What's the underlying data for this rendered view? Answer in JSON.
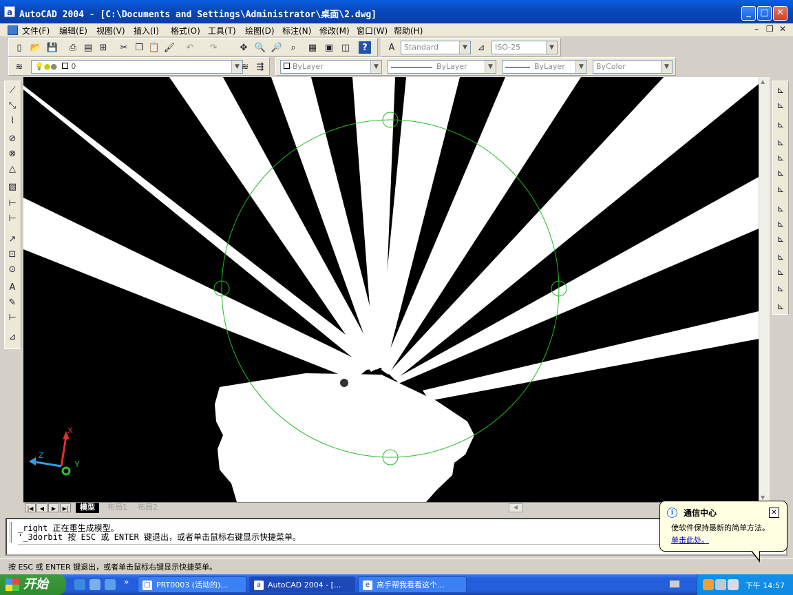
{
  "window": {
    "app_icon": "a",
    "title": "AutoCAD 2004 - [C:\\Documents and Settings\\Administrator\\桌面\\2.dwg]",
    "controls": {
      "minimize": "_",
      "maximize": "□",
      "close": "✕"
    }
  },
  "menu": {
    "items": [
      "文件(F)",
      "编辑(E)",
      "视图(V)",
      "插入(I)",
      "格式(O)",
      "工具(T)",
      "绘图(D)",
      "标注(N)",
      "修改(M)",
      "窗口(W)",
      "帮助(H)"
    ],
    "mdi": {
      "minimize": "–",
      "restore": "❐",
      "close": "✕"
    }
  },
  "toolbar": {
    "text_style": "Standard",
    "dim_style": "ISO-25",
    "layer": "0",
    "color": "ByLayer",
    "linetype": "ByLayer",
    "lineweight": "ByLayer",
    "plot_style": "ByColor"
  },
  "ucs": {
    "x_label": "X",
    "y_label": "Y",
    "z_label": "Z"
  },
  "layout_tabs": [
    "模型",
    "布局1",
    "布局2"
  ],
  "command": {
    "lines": [
      "_right 正在重生成模型。",
      "'_3dorbit 按 ESC 或 ENTER 键退出，或者单击鼠标右键显示快捷菜单。"
    ],
    "prompt": ""
  },
  "status_bar": {
    "text": "按 ESC 或 ENTER 键退出，或者单击鼠标右键显示快捷菜单。"
  },
  "balloon": {
    "title": "通信中心",
    "body": "使软件保持最新的简单方法。",
    "link": "单击此处。",
    "close": "✕"
  },
  "taskbar": {
    "start_label": "开始",
    "more": "»",
    "tasks": [
      {
        "label": "PRT0003 (活动的)...",
        "icon": "▢"
      },
      {
        "label": "AutoCAD 2004 - [...",
        "icon": "a"
      },
      {
        "label": "高手帮我看看这个...",
        "icon": "e"
      }
    ],
    "clock": "下午 14:57"
  },
  "colors": {
    "orbit": "#22bb22",
    "canvas": "#000000",
    "geometry": "#ffffff",
    "titlebar": "#0a5fdf",
    "taskbar": "#245edb"
  }
}
